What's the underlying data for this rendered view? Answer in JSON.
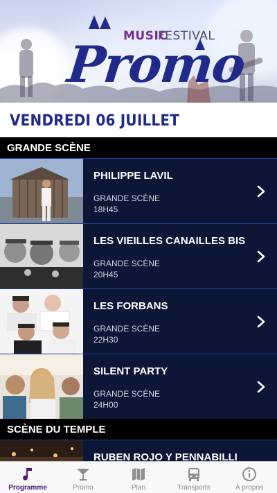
{
  "header": {
    "logo_music": "MUSIC",
    "logo_festival": "FESTIVAL",
    "logo_promo": "Promo"
  },
  "date_label": "VENDREDI 06 JUILLET",
  "sections": [
    {
      "title": "GRANDE SCÈNE",
      "items": [
        {
          "title": "PHILIPPE LAVIL",
          "stage": "GRANDE SCÈNE",
          "time": "18H45"
        },
        {
          "title": "LES VIEILLES CANAILLES BIS",
          "stage": "GRANDE SCÈNE",
          "time": "20H45"
        },
        {
          "title": "LES FORBANS",
          "stage": "GRANDE SCÈNE",
          "time": "22H30"
        },
        {
          "title": "SILENT PARTY",
          "stage": "GRANDE SCÈNE",
          "time": "24H00"
        }
      ]
    },
    {
      "title": "SCÈNE DU TEMPLE",
      "items": [
        {
          "title": "RUBEN ROJO Y PENNABILLI"
        }
      ]
    }
  ],
  "tabbar": {
    "items": [
      {
        "label": "Programme",
        "icon": "music-note-icon",
        "active": true
      },
      {
        "label": "Promo",
        "icon": "cocktail-icon",
        "active": false
      },
      {
        "label": "Plan",
        "icon": "map-icon",
        "active": false
      },
      {
        "label": "Transports",
        "icon": "bus-icon",
        "active": false
      },
      {
        "label": "À propos",
        "icon": "info-icon",
        "active": false
      }
    ]
  },
  "colors": {
    "brand_blue": "#1f2a8a",
    "brand_purple": "#7a2c8f",
    "row_bg": "#0c1636",
    "active_tab": "#4b1a78"
  }
}
